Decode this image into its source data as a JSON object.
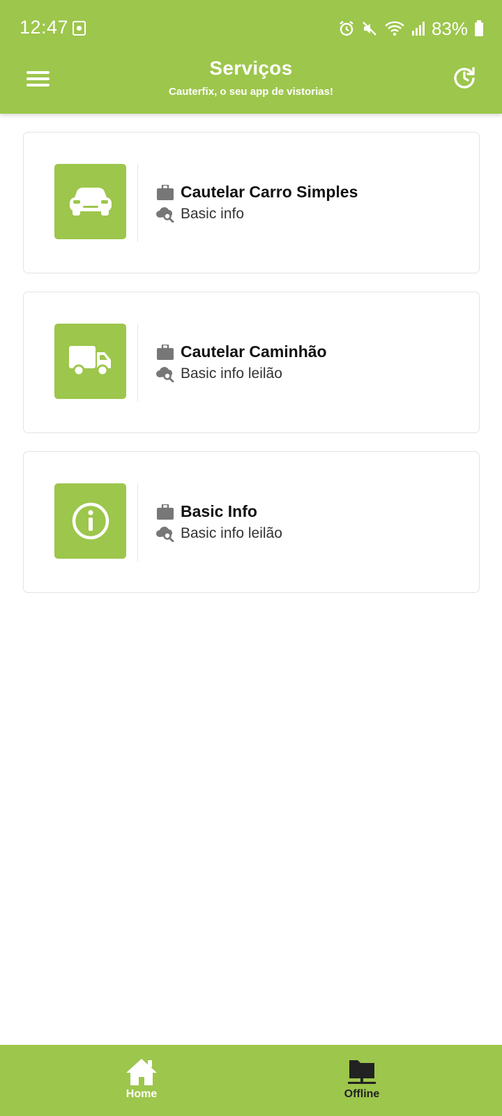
{
  "status_bar": {
    "time": "12:47",
    "battery": "83%"
  },
  "app_bar": {
    "title": "Serviços",
    "subtitle": "Cauterfix, o seu app de vistorias!"
  },
  "services": [
    {
      "title": "Cautelar Carro Simples",
      "subtitle": "Basic info",
      "icon": "car-icon"
    },
    {
      "title": "Cautelar Caminhão",
      "subtitle": "Basic info leilão",
      "icon": "truck-icon"
    },
    {
      "title": "Basic Info",
      "subtitle": "Basic info leilão",
      "icon": "info-icon"
    }
  ],
  "bottom_nav": {
    "home_label": "Home",
    "offline_label": "Offline"
  },
  "colors": {
    "primary": "#9dc64c",
    "icon_gray": "#777777"
  }
}
